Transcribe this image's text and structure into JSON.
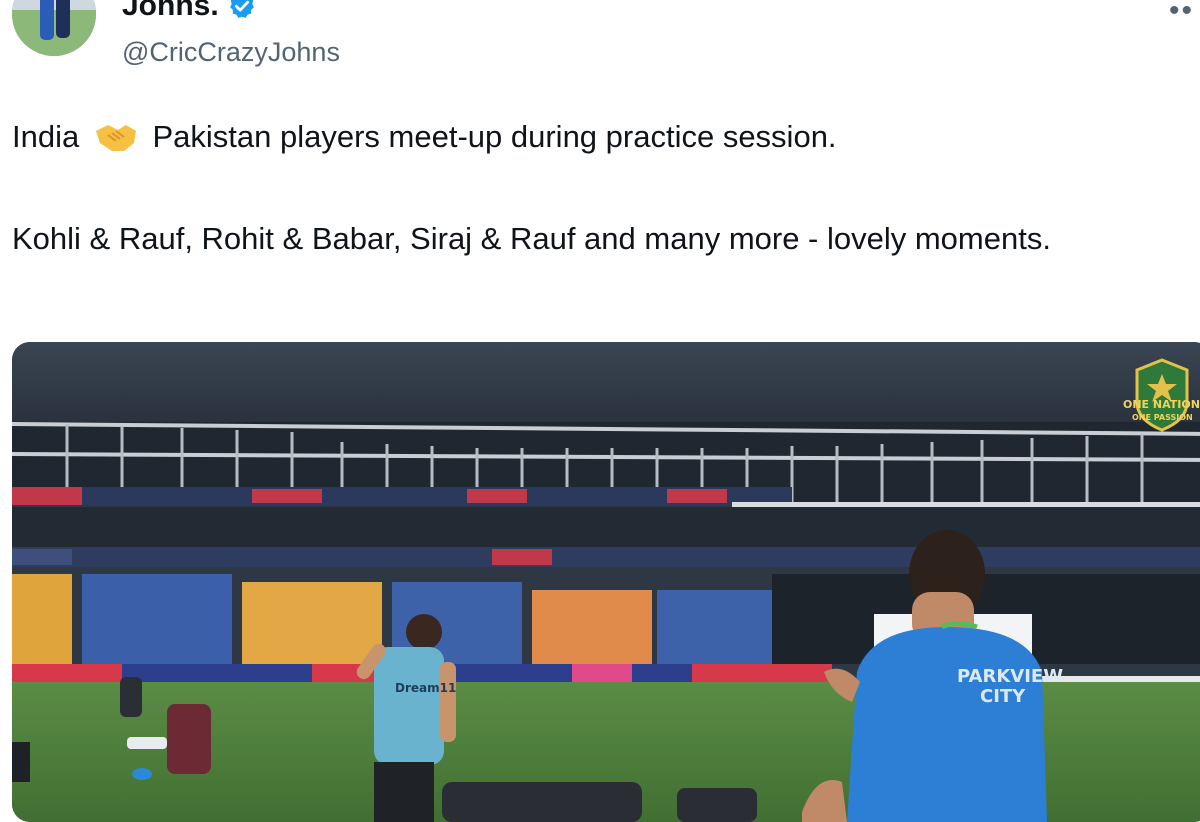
{
  "author": {
    "name": "Johns.",
    "handle": "@CricCrazyJohns",
    "verified_color": "#1d9bf0"
  },
  "tweet": {
    "line1_before": "India",
    "line1_emoji": "handshake-icon",
    "line1_after": "Pakistan players meet-up during practice session.",
    "line2": "Kohli & Rauf, Rohit & Babar, Siraj & Rauf and many more - lovely moments."
  },
  "media": {
    "badge_line1": "ONE NATION",
    "badge_line2": "ONE PASSION",
    "jersey_text_1": "PARKVIEW",
    "jersey_text_2": "CITY",
    "shirt_text": "Dream11"
  },
  "colors": {
    "text_primary": "#0f1419",
    "text_secondary": "#536471",
    "pitch_green": "#4f7f3c",
    "jersey_blue": "#2d7fd6"
  }
}
